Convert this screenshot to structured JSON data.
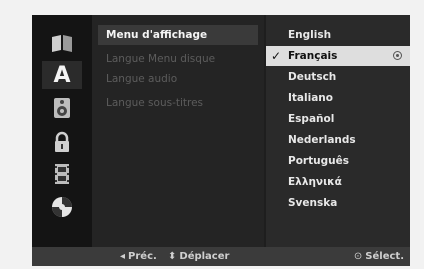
{
  "sidebar": {
    "icons": [
      {
        "name": "disc-menu-icon"
      },
      {
        "name": "language-icon",
        "letter": "A"
      },
      {
        "name": "audio-icon"
      },
      {
        "name": "lock-icon"
      },
      {
        "name": "recording-icon"
      },
      {
        "name": "others-icon"
      }
    ]
  },
  "menu": {
    "items": [
      {
        "label": "Menu d'affichage"
      },
      {
        "label": "Langue Menu disque"
      },
      {
        "label": "Langue audio"
      },
      {
        "label": "Langue sous-titres"
      }
    ]
  },
  "languages": {
    "items": [
      {
        "label": "English"
      },
      {
        "label": "Français",
        "selected": true
      },
      {
        "label": "Deutsch"
      },
      {
        "label": "Italiano"
      },
      {
        "label": "Español"
      },
      {
        "label": "Nederlands"
      },
      {
        "label": "Português"
      },
      {
        "label": "Ελληνικά"
      },
      {
        "label": "Svenska"
      }
    ],
    "check_glyph": "✓"
  },
  "footer": {
    "prev_glyph": "◂",
    "prev_label": "Préc.",
    "move_glyph": "⬍",
    "move_label": "Déplacer",
    "select_glyph": "⊙",
    "select_label": "Sélect."
  },
  "colors": {
    "panel": "#1e1e1e",
    "highlight": "#dedede",
    "footer": "#3b3b3b"
  }
}
